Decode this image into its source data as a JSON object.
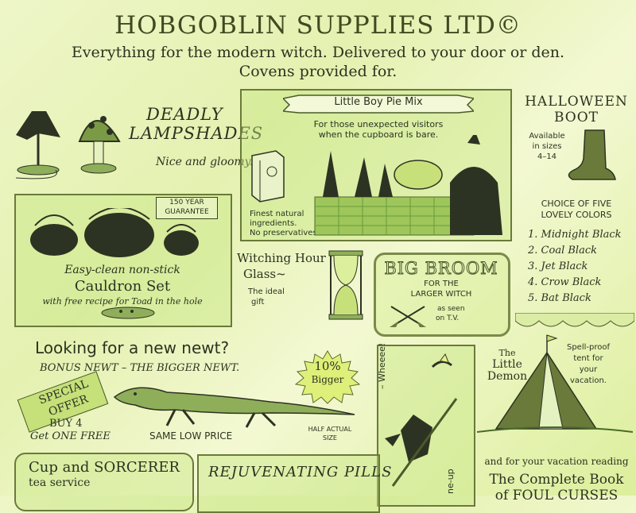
{
  "header": {
    "title": "HOBGOBLIN SUPPLIES LTD©",
    "tagline_1": "Everything for the modern witch. Delivered to your door or den.",
    "tagline_2": "Covens provided for."
  },
  "lampshades": {
    "title_1": "DEADLY",
    "title_2": "LAMPSHADES",
    "caption": "Nice and gloomy."
  },
  "pie_mix": {
    "banner": "Little Boy Pie Mix",
    "desc_1": "For those unexpected visitors",
    "desc_2": "when the cupboard is bare.",
    "note_1": "Finest natural",
    "note_2": "ingredients.",
    "note_3": "No preservatives."
  },
  "boot": {
    "title_1": "HALLOWEEN",
    "title_2": "BOOT",
    "avail_1": "Available",
    "avail_2": "in sizes",
    "avail_3": "4–14",
    "choice_1": "CHOICE OF FIVE",
    "choice_2": "LOVELY COLORS",
    "colors": [
      "Midnight Black",
      "Coal Black",
      "Jet Black",
      "Crow Black",
      "Bat Black"
    ]
  },
  "cauldron": {
    "guarantee_1": "150 YEAR",
    "guarantee_2": "GUARANTEE",
    "line_1": "Easy-clean non-stick",
    "line_2": "Cauldron Set",
    "line_3": "with free recipe for Toad in the hole"
  },
  "hourglass": {
    "title_1": "Witching Hour",
    "title_2": "Glass~",
    "caption_1": "The ideal",
    "caption_2": "gift"
  },
  "broom": {
    "title": "BIG BROOM",
    "sub_1": "FOR THE",
    "sub_2": "LARGER WITCH",
    "seen_1": "as seen",
    "seen_2": "on T.V."
  },
  "newt": {
    "heading": "Looking for a new newt?",
    "bonus": "BONUS NEWT – THE BIGGER NEWT.",
    "offer_1": "SPECIAL",
    "offer_2": "OFFER",
    "buy_1": "BUY 4",
    "buy_2": "Get ONE FREE",
    "badge_1": "10%",
    "badge_2": "Bigger",
    "price": "SAME LOW PRICE",
    "half_1": "HALF ACTUAL",
    "half_2": "SIZE"
  },
  "wheee": {
    "shout": "– Wheeee!",
    "side": "ne-up"
  },
  "demon": {
    "title_1": "The",
    "title_2": "Little",
    "title_3": "Demon",
    "desc_1": "Spell-proof",
    "desc_2": "tent for",
    "desc_3": "your",
    "desc_4": "vacation."
  },
  "reading": {
    "line": "and for your vacation reading",
    "book_1": "The Complete Book",
    "book_2": "of FOUL CURSES"
  },
  "tea": {
    "title": "Cup and SORCERER",
    "sub": "tea service"
  },
  "pills": {
    "title": "REJUVENATING PILLS"
  },
  "colors": {
    "ink": "#2b3320",
    "accent_green": "#6a7a3a"
  }
}
